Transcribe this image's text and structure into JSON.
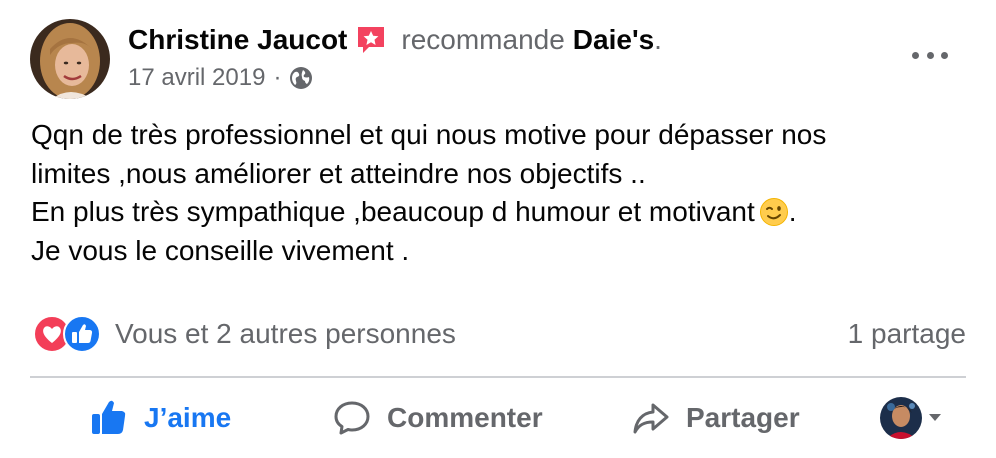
{
  "post": {
    "author": "Christine Jaucot",
    "verb": "recommande",
    "page": "Daie's",
    "period": ".",
    "date": "17 avril 2019",
    "separator": "·",
    "audience_icon": "globe-icon",
    "more_icon": "more-options-icon",
    "badge_icon": "recommendation-star-icon",
    "text_lines": [
      "Qqn de très professionnel et qui nous motive pour dépasser nos",
      "limites ,nous améliorer et atteindre nos objectifs ..",
      "En plus très sympathique ,beaucoup d humour et motivant",
      "Je vous le conseille vivement ."
    ],
    "line3_suffix": ".",
    "emoji": "winking-face-icon"
  },
  "reactions": {
    "icons": [
      "love-reaction-icon",
      "like-reaction-icon"
    ],
    "summary": "Vous et 2 autres personnes",
    "shares": "1 partage"
  },
  "actions": {
    "like": "J’aime",
    "comment": "Commenter",
    "share": "Partager"
  },
  "colors": {
    "like_blue": "#1877f2",
    "love_red": "#f33e58",
    "secondary_text": "#65676b",
    "badge_red": "#f3425f"
  }
}
